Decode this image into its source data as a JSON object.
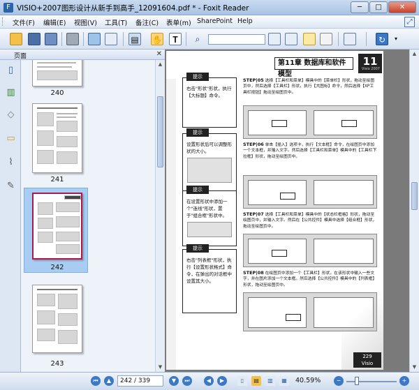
{
  "window": {
    "title": "VISIO+2007图形设计从新手到高手_12091604.pdf * - Foxit Reader",
    "minimize": "─",
    "maximize": "□",
    "close": "✕"
  },
  "menu": {
    "items": [
      "文件(F)",
      "编辑(E)",
      "视图(V)",
      "工具(T)",
      "备注(C)",
      "表单(m)",
      "SharePoint",
      "Help"
    ]
  },
  "toolbar": {
    "icons": [
      "open-icon",
      "save-icon",
      "save-as-icon",
      "print-icon",
      "screen-icon",
      "email-icon",
      "page-options-icon",
      "hand-tool-icon",
      "select-text-icon",
      "binoculars-icon",
      "prev-result-icon",
      "next-result-icon",
      "comments-icon",
      "highlight-icon",
      "text-markup-icon",
      "tools-icon",
      "navigate-icon"
    ]
  },
  "left_panel": {
    "title": "页面",
    "close_glyph": "✕",
    "pages": [
      {
        "label": "240"
      },
      {
        "label": "241"
      },
      {
        "label": "242",
        "selected": true
      },
      {
        "label": "243"
      }
    ]
  },
  "document": {
    "chapter_title": "第11章   数据库和软件模型",
    "chapter_number": "11",
    "chapter_sub": "Visio 2007",
    "tips": [
      {
        "head": "提示",
        "text": "右击\"形状\"形状，执行【大标题】命令。"
      },
      {
        "head": "提示",
        "text": "设置形状后可以调整形状的大小。"
      },
      {
        "head": "提示",
        "text": "在设置形状中添加一个\"连线\"形状，置于\"组合框\"形状中。"
      },
      {
        "head": "提示",
        "text": "右击\"列表框\"形状，执行【设置形状格式】命令，在弹出的对话框中设置其大小。"
      }
    ],
    "steps": [
      {
        "num": "STEP|05",
        "text": "选择【工具栏和菜单】模具中的【菜单栏】形状，拖动至绘图页中，然后选择【工具栏】形状，执行【大图标】命令，然后选择【XP工具栏按钮】拖动至绘图页中。"
      },
      {
        "num": "STEP|06",
        "text": "单击【插入】选项卡，执行【文本框】命令，在绘图页中添加一个文本框，并输入文字。然后选择【工具栏和菜单】模具中的【工具栏下拉框】形状，拖动至绘图页中。"
      },
      {
        "num": "STEP|07",
        "text": "选择【工具栏和菜单】模具中的【状态栏框格】形状，拖动至绘图页中，并输入文字。然后在【公共控件】模具中选择【组合框】形状，拖动至绘图页中。"
      },
      {
        "num": "STEP|08",
        "text": "在绘图页中添加一个【工具栏】形状，在该形状中输入一些文字，并在图片添加一个文本框。然后选择【公共控件】模具中的【列表框】形状，拖动至绘图页中。"
      }
    ],
    "footer_number": "229",
    "footer_text": "Visio"
  },
  "statusbar": {
    "page_field": "242 / 339",
    "zoom": "40.59%"
  },
  "colors": {
    "selected_thumb_border": "#b2174c",
    "selected_thumb_bg": "#a9cdf2",
    "doc_background": "#7a7a7a"
  }
}
